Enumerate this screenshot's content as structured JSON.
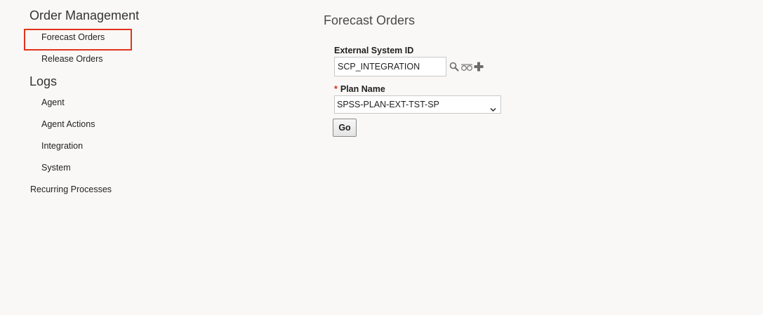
{
  "sidebar": {
    "order_management": {
      "heading": "Order Management",
      "items": [
        {
          "label": "Forecast Orders"
        },
        {
          "label": "Release Orders"
        }
      ]
    },
    "logs": {
      "heading": "Logs",
      "items": [
        {
          "label": "Agent"
        },
        {
          "label": "Agent Actions"
        },
        {
          "label": "Integration"
        },
        {
          "label": "System"
        }
      ]
    },
    "recurring_processes": {
      "label": "Recurring Processes"
    },
    "highlight_color": "#e0331c"
  },
  "main": {
    "title": "Forecast Orders",
    "external_system": {
      "label": "External System ID",
      "value": "SCP_INTEGRATION",
      "icons": [
        "search-icon",
        "glasses-icon",
        "plus-icon"
      ]
    },
    "plan_name": {
      "required_marker": "*",
      "label": "Plan Name",
      "selected": "SPSS-PLAN-EXT-TST-SP"
    },
    "go_button": {
      "label": "Go"
    }
  }
}
